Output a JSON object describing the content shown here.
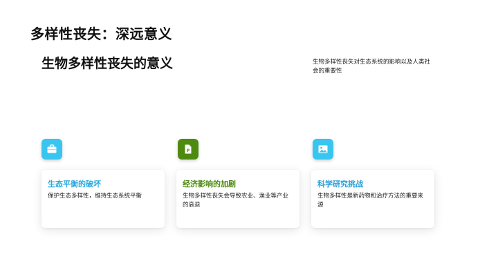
{
  "slide": {
    "title": "多样性丧失：深远意义",
    "section_title": "生物多样性丧失的意义",
    "section_desc": "生物多样性丧失对生态系统的影响以及人类社会的重要性"
  },
  "colors": {
    "cyan": "#38c6f0",
    "green": "#4f8a10",
    "card_title_1": "#2aa8dc",
    "card_title_2": "#4f8a10",
    "card_title_3": "#2a9fd6"
  },
  "cards": [
    {
      "icon": "briefcase-icon",
      "title": "生态平衡的破坏",
      "text": "保护生态多样性，维持生态系统平衡"
    },
    {
      "icon": "document-icon",
      "title": "经济影响的加剧",
      "text": "生物多样性丧失会导致农业、渔业等产业的衰退"
    },
    {
      "icon": "image-icon",
      "title": "科学研究挑战",
      "text": "生物多样性是新药物和治疗方法的重要来源"
    }
  ]
}
